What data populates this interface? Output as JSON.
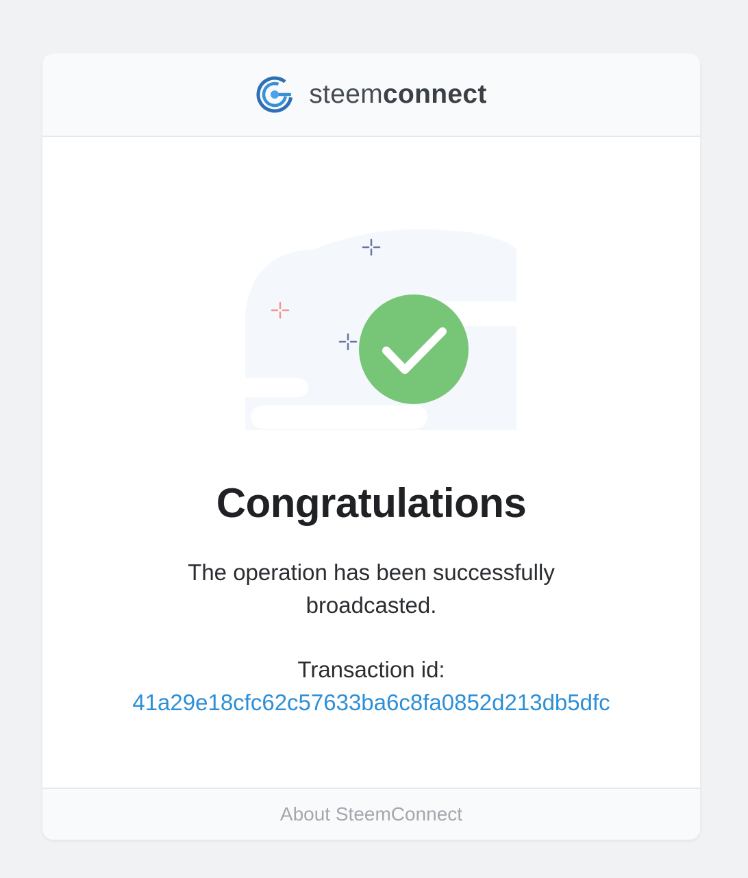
{
  "header": {
    "brand_light": "steem",
    "brand_bold": "connect",
    "logo_icon": "steemconnect-logo-icon",
    "accent_color": "#2d8fd6"
  },
  "main": {
    "illustration_icon": "success-checkmark-icon",
    "success_color": "#77c576",
    "title": "Congratulations",
    "message": "The operation has been successfully broadcasted.",
    "transaction_label": "Transaction id:",
    "transaction_id": "41a29e18cfc62c57633ba6c8fa0852d213db5dfc",
    "link_color": "#2d8fd6"
  },
  "footer": {
    "link_label": "About SteemConnect"
  }
}
